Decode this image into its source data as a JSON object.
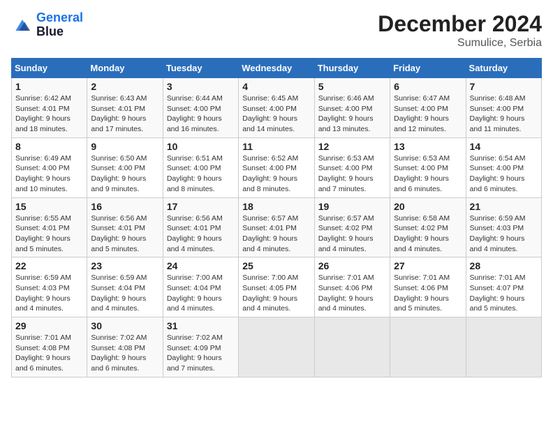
{
  "header": {
    "logo_line1": "General",
    "logo_line2": "Blue",
    "month_year": "December 2024",
    "location": "Sumulice, Serbia"
  },
  "weekdays": [
    "Sunday",
    "Monday",
    "Tuesday",
    "Wednesday",
    "Thursday",
    "Friday",
    "Saturday"
  ],
  "weeks": [
    [
      {
        "day": "1",
        "info": "Sunrise: 6:42 AM\nSunset: 4:01 PM\nDaylight: 9 hours\nand 18 minutes."
      },
      {
        "day": "2",
        "info": "Sunrise: 6:43 AM\nSunset: 4:01 PM\nDaylight: 9 hours\nand 17 minutes."
      },
      {
        "day": "3",
        "info": "Sunrise: 6:44 AM\nSunset: 4:00 PM\nDaylight: 9 hours\nand 16 minutes."
      },
      {
        "day": "4",
        "info": "Sunrise: 6:45 AM\nSunset: 4:00 PM\nDaylight: 9 hours\nand 14 minutes."
      },
      {
        "day": "5",
        "info": "Sunrise: 6:46 AM\nSunset: 4:00 PM\nDaylight: 9 hours\nand 13 minutes."
      },
      {
        "day": "6",
        "info": "Sunrise: 6:47 AM\nSunset: 4:00 PM\nDaylight: 9 hours\nand 12 minutes."
      },
      {
        "day": "7",
        "info": "Sunrise: 6:48 AM\nSunset: 4:00 PM\nDaylight: 9 hours\nand 11 minutes."
      }
    ],
    [
      {
        "day": "8",
        "info": "Sunrise: 6:49 AM\nSunset: 4:00 PM\nDaylight: 9 hours\nand 10 minutes."
      },
      {
        "day": "9",
        "info": "Sunrise: 6:50 AM\nSunset: 4:00 PM\nDaylight: 9 hours\nand 9 minutes."
      },
      {
        "day": "10",
        "info": "Sunrise: 6:51 AM\nSunset: 4:00 PM\nDaylight: 9 hours\nand 8 minutes."
      },
      {
        "day": "11",
        "info": "Sunrise: 6:52 AM\nSunset: 4:00 PM\nDaylight: 9 hours\nand 8 minutes."
      },
      {
        "day": "12",
        "info": "Sunrise: 6:53 AM\nSunset: 4:00 PM\nDaylight: 9 hours\nand 7 minutes."
      },
      {
        "day": "13",
        "info": "Sunrise: 6:53 AM\nSunset: 4:00 PM\nDaylight: 9 hours\nand 6 minutes."
      },
      {
        "day": "14",
        "info": "Sunrise: 6:54 AM\nSunset: 4:00 PM\nDaylight: 9 hours\nand 6 minutes."
      }
    ],
    [
      {
        "day": "15",
        "info": "Sunrise: 6:55 AM\nSunset: 4:01 PM\nDaylight: 9 hours\nand 5 minutes."
      },
      {
        "day": "16",
        "info": "Sunrise: 6:56 AM\nSunset: 4:01 PM\nDaylight: 9 hours\nand 5 minutes."
      },
      {
        "day": "17",
        "info": "Sunrise: 6:56 AM\nSunset: 4:01 PM\nDaylight: 9 hours\nand 4 minutes."
      },
      {
        "day": "18",
        "info": "Sunrise: 6:57 AM\nSunset: 4:01 PM\nDaylight: 9 hours\nand 4 minutes."
      },
      {
        "day": "19",
        "info": "Sunrise: 6:57 AM\nSunset: 4:02 PM\nDaylight: 9 hours\nand 4 minutes."
      },
      {
        "day": "20",
        "info": "Sunrise: 6:58 AM\nSunset: 4:02 PM\nDaylight: 9 hours\nand 4 minutes."
      },
      {
        "day": "21",
        "info": "Sunrise: 6:59 AM\nSunset: 4:03 PM\nDaylight: 9 hours\nand 4 minutes."
      }
    ],
    [
      {
        "day": "22",
        "info": "Sunrise: 6:59 AM\nSunset: 4:03 PM\nDaylight: 9 hours\nand 4 minutes."
      },
      {
        "day": "23",
        "info": "Sunrise: 6:59 AM\nSunset: 4:04 PM\nDaylight: 9 hours\nand 4 minutes."
      },
      {
        "day": "24",
        "info": "Sunrise: 7:00 AM\nSunset: 4:04 PM\nDaylight: 9 hours\nand 4 minutes."
      },
      {
        "day": "25",
        "info": "Sunrise: 7:00 AM\nSunset: 4:05 PM\nDaylight: 9 hours\nand 4 minutes."
      },
      {
        "day": "26",
        "info": "Sunrise: 7:01 AM\nSunset: 4:06 PM\nDaylight: 9 hours\nand 4 minutes."
      },
      {
        "day": "27",
        "info": "Sunrise: 7:01 AM\nSunset: 4:06 PM\nDaylight: 9 hours\nand 5 minutes."
      },
      {
        "day": "28",
        "info": "Sunrise: 7:01 AM\nSunset: 4:07 PM\nDaylight: 9 hours\nand 5 minutes."
      }
    ],
    [
      {
        "day": "29",
        "info": "Sunrise: 7:01 AM\nSunset: 4:08 PM\nDaylight: 9 hours\nand 6 minutes."
      },
      {
        "day": "30",
        "info": "Sunrise: 7:02 AM\nSunset: 4:08 PM\nDaylight: 9 hours\nand 6 minutes."
      },
      {
        "day": "31",
        "info": "Sunrise: 7:02 AM\nSunset: 4:09 PM\nDaylight: 9 hours\nand 7 minutes."
      },
      null,
      null,
      null,
      null
    ]
  ]
}
